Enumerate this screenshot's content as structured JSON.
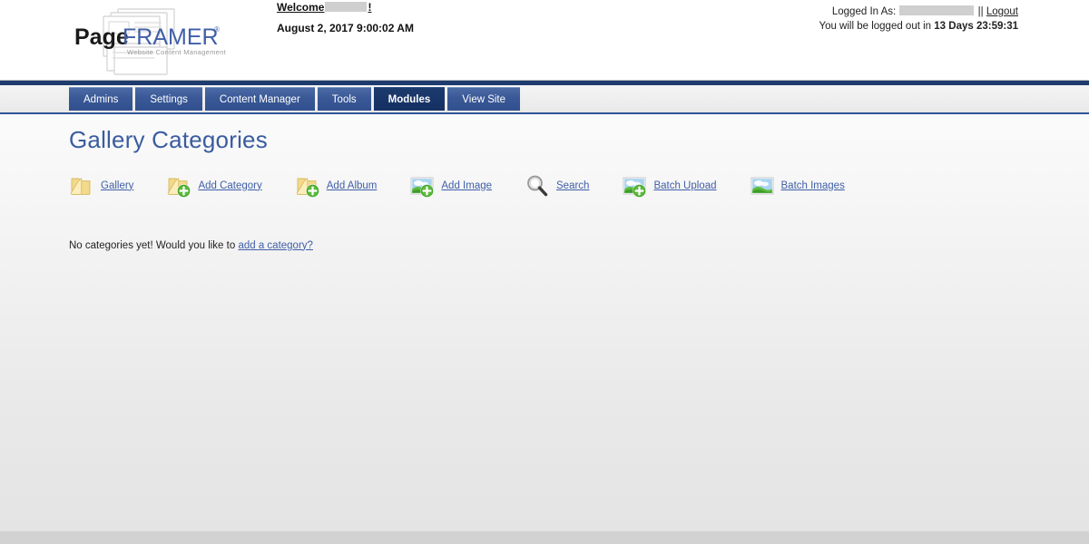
{
  "brand": {
    "name_part1": "Page",
    "name_part2": "FRAMER",
    "trademark": "®",
    "tagline": "Website Content Management"
  },
  "header": {
    "welcome_label": "Welcome",
    "welcome_suffix": "!",
    "datetime": "August 2, 2017 9:00:02 AM",
    "logged_in_label": "Logged In As:",
    "separator": "||",
    "logout_label": "Logout",
    "logout_timer_prefix": "You will be logged out in",
    "logout_timer_value": "13 Days 23:59:31"
  },
  "nav": {
    "tabs": [
      {
        "label": "Admins",
        "active": false
      },
      {
        "label": "Settings",
        "active": false
      },
      {
        "label": "Content Manager",
        "active": false
      },
      {
        "label": "Tools",
        "active": false
      },
      {
        "label": "Modules",
        "active": true
      },
      {
        "label": "View Site",
        "active": false
      }
    ]
  },
  "main": {
    "page_title": "Gallery Categories",
    "toolbar": [
      {
        "label": "Gallery",
        "icon": "folder-icon"
      },
      {
        "label": "Add Category",
        "icon": "folder-add-icon"
      },
      {
        "label": "Add Album",
        "icon": "folder-add-icon"
      },
      {
        "label": "Add Image",
        "icon": "image-add-icon"
      },
      {
        "label": "Search",
        "icon": "search-icon"
      },
      {
        "label": "Batch Upload",
        "icon": "image-add-icon"
      },
      {
        "label": "Batch Images",
        "icon": "image-icon"
      }
    ],
    "empty_state_text": "No categories yet! Would you like to",
    "empty_state_link": "add a category?"
  },
  "colors": {
    "accent_blue": "#3a5ca0",
    "tab_blue": "#3a5896",
    "tab_active_navy": "#1c3a6d",
    "link_blue": "#3f5ea8",
    "page_bg": "#d2d2d2"
  }
}
